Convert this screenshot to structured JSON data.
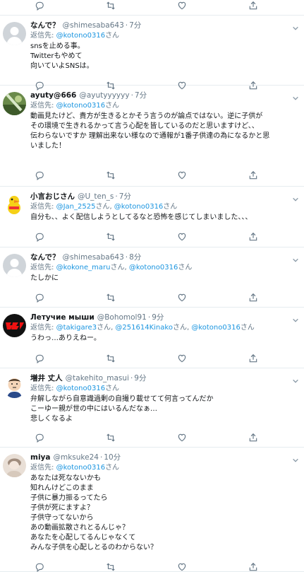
{
  "tweets": [
    {
      "name": "なんで？",
      "handle": "@shimesaba643",
      "time": "7分",
      "reply_label": "返信先:",
      "reply_to": [
        "@kotono0316"
      ],
      "reply_suffix": "さん",
      "lines": [
        "snsを止める事。",
        "Twitterもやめて",
        "向いていよSNSは。"
      ],
      "avatar": "default-person"
    },
    {
      "name": "ayuty@666",
      "handle": "@ayutyyyyyy",
      "time": "7分",
      "reply_label": "返信先:",
      "reply_to": [
        "@kotono0316"
      ],
      "reply_suffix": "さん",
      "lines": [
        "動画見たけど、貴方が生きるとかそう言うのが論点ではない。逆に子供が",
        "その環境で生きれるかって言う心配を皆しているのだと思いますけど、、",
        "伝わらないですか 理解出来ない様なので通報が1番子供達の為になるかと思",
        "いました！"
      ],
      "avatar": "photo"
    },
    {
      "name": "小言おじさん",
      "handle": "@U_ten_s",
      "time": "7分",
      "reply_label": "返信先:",
      "reply_to": [
        "@Jan_2525",
        "@kotono0316"
      ],
      "reply_suffix": "さん",
      "lines": [
        "自分も、、よく配信しようとしてるなと恐怖を感じてしまいました、、、"
      ],
      "avatar": "duck"
    },
    {
      "name": "なんで？",
      "handle": "@shimesaba643",
      "time": "8分",
      "reply_label": "返信先:",
      "reply_to": [
        "@kokone_maru",
        "@kotono0316"
      ],
      "reply_suffix": "さん",
      "lines": [
        "たしかに"
      ],
      "avatar": "default-person"
    },
    {
      "name": "Летучие мыши",
      "handle": "@Bohomol91",
      "time": "9分",
      "reply_label": "返信先:",
      "reply_to": [
        "@takigare3",
        "@251614Kinako",
        "@kotono0316"
      ],
      "reply_suffix": "さん",
      "lines": [
        "うわっ…ありえねー。"
      ],
      "avatar": "red-logo"
    },
    {
      "name": "増井 丈人",
      "handle": "@takehito_masui",
      "time": "9分",
      "reply_label": "返信先:",
      "reply_to": [
        "@kotono0316"
      ],
      "reply_suffix": "さん",
      "lines": [
        "弁解しながら自意識過剰の自撮り載せてて何言ってんだか",
        "こーゆー親が世の中にはいるんだなぁ…",
        "悲しくなるよ"
      ],
      "avatar": "cartoon-man"
    },
    {
      "name": "miya",
      "handle": "@mksuke24",
      "time": "10分",
      "reply_label": "返信先:",
      "reply_to": [
        "@kotono0316"
      ],
      "reply_suffix": "さん",
      "lines": [
        "あなたは死なないかも",
        "知れんけどこのまま",
        "子供に暴力振るってたら",
        "子供が死にますよ？",
        "子供守ってないから",
        "あの動画拡散されとるんじゃ？",
        "あなたを心配してるんじゃなくて",
        "みんな子供を心配しとるのわからない？"
      ],
      "avatar": "photo-light"
    }
  ],
  "action_icons": [
    "reply-icon",
    "retweet-icon",
    "like-icon",
    "share-icon"
  ],
  "colors": {
    "link": "#1b95e0",
    "muted": "#657786",
    "border": "#e6ecf0",
    "text": "#14171a"
  }
}
